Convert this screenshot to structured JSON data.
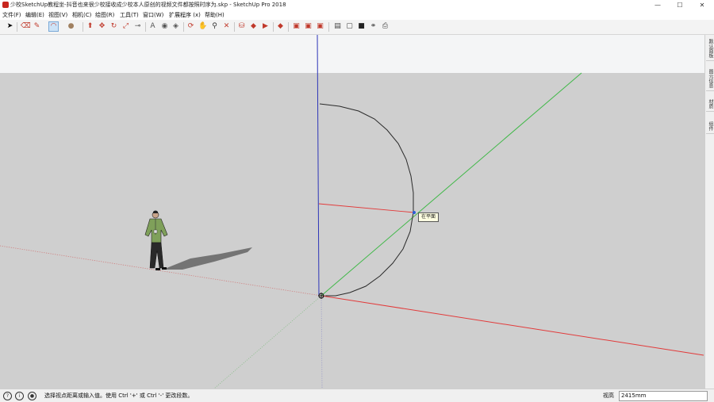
{
  "window": {
    "title": "少校SketchUp教程坐-抖音也来很少校接收成少校本人原创的视频文件都按照时序为.skp - SketchUp Pro 2018",
    "minimize_glyph": "—",
    "maximize_glyph": "☐",
    "close_glyph": "✕"
  },
  "menu": {
    "items": [
      {
        "label": "文件(F)"
      },
      {
        "label": "编辑(E)"
      },
      {
        "label": "视图(V)"
      },
      {
        "label": "相机(C)"
      },
      {
        "label": "绘图(R)"
      },
      {
        "label": "工具(T)"
      },
      {
        "label": "窗口(W)"
      },
      {
        "label": "扩展程序 (x)"
      },
      {
        "label": "帮助(H)"
      }
    ]
  },
  "toolbar": {
    "icons": [
      {
        "name": "select-arrow-icon",
        "glyph": "➤"
      },
      {
        "name": "eraser-icon",
        "glyph": "⌫"
      },
      {
        "name": "pencil-line-icon",
        "glyph": "✎"
      },
      {
        "name": "arc-tool-icon",
        "glyph": "◠"
      },
      {
        "name": "shape-circle-icon",
        "glyph": "●"
      },
      {
        "name": "push-pull-icon",
        "glyph": "⬆"
      },
      {
        "name": "move-icon",
        "glyph": "✥"
      },
      {
        "name": "rotate-icon",
        "glyph": "↻"
      },
      {
        "name": "scale-icon",
        "glyph": "⤢"
      },
      {
        "name": "tape-measure-icon",
        "glyph": "⊸"
      },
      {
        "name": "text-icon",
        "glyph": "A"
      },
      {
        "name": "paint-bucket-icon",
        "glyph": "◉"
      },
      {
        "name": "orbit-icon",
        "glyph": "⟳"
      },
      {
        "name": "pan-icon",
        "glyph": "✋"
      },
      {
        "name": "zoom-icon",
        "glyph": "⚲"
      },
      {
        "name": "zoom-extents-icon",
        "glyph": "✕"
      },
      {
        "name": "warehouse-icon",
        "glyph": "⛁"
      },
      {
        "name": "components-icon",
        "glyph": "◈"
      },
      {
        "name": "extension-warehouse-icon",
        "glyph": "◆"
      },
      {
        "name": "send-layout-icon",
        "glyph": "▶"
      },
      {
        "name": "ruby-icon",
        "glyph": "◆"
      },
      {
        "name": "sections-icon",
        "glyph": "▣"
      },
      {
        "name": "layer-icon",
        "glyph": "▤"
      },
      {
        "name": "folder-icon",
        "glyph": "▢"
      },
      {
        "name": "save-icon",
        "glyph": "■"
      },
      {
        "name": "link-icon",
        "glyph": "⚭"
      },
      {
        "name": "print-icon",
        "glyph": "⎙"
      }
    ]
  },
  "right_panel": {
    "tabs": [
      {
        "label": "默认面板"
      },
      {
        "label": "图元信息"
      },
      {
        "label": "材质"
      },
      {
        "label": "组件"
      }
    ]
  },
  "viewport": {
    "tooltip": "在平面",
    "sky_color": "#f4f5f6",
    "ground_color": "#cfcfcf",
    "red_axis": "#e23a3a",
    "green_axis": "#3fb847",
    "blue_axis": "#2d35b8"
  },
  "statusbar": {
    "hint": "选择视点距离或输入值。使用 Ctrl '+' 或 Ctrl '-' 更改段数。",
    "measure_label": "视高",
    "measure_value": "2415mm"
  }
}
